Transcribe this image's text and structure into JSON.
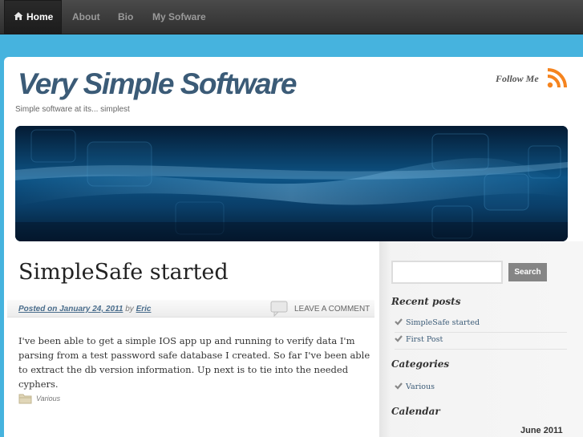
{
  "nav": {
    "home": "Home",
    "about": "About",
    "bio": "Bio",
    "my_software": "My Sofware"
  },
  "site": {
    "title": "Very Simple Software",
    "tagline": "Simple software at its... simplest",
    "follow_label": "Follow Me"
  },
  "post": {
    "title": "SimpleSafe started",
    "posted_on": "Posted on January 24, 2011",
    "by": "by",
    "author": "Eric",
    "leave_comment": "LEAVE A COMMENT",
    "body": "I've been able to get a simple IOS app up and running to verify data I'm parsing from a test password safe database I created. So far I've been able to extract the db version information. Up next is to tie into the needed cyphers.",
    "category": "Various"
  },
  "sidebar": {
    "search_button": "Search",
    "search_value": "",
    "recent_posts_title": "Recent posts",
    "recent_posts": [
      "SimpleSafe started",
      "First Post"
    ],
    "categories_title": "Categories",
    "categories": [
      "Various"
    ],
    "calendar_title": "Calendar",
    "calendar_month": "June 2011"
  },
  "colors": {
    "background": "#46b3de",
    "title": "#3b5b77",
    "rss": "#f5841f",
    "nav_bar": "#3a3a3a"
  }
}
